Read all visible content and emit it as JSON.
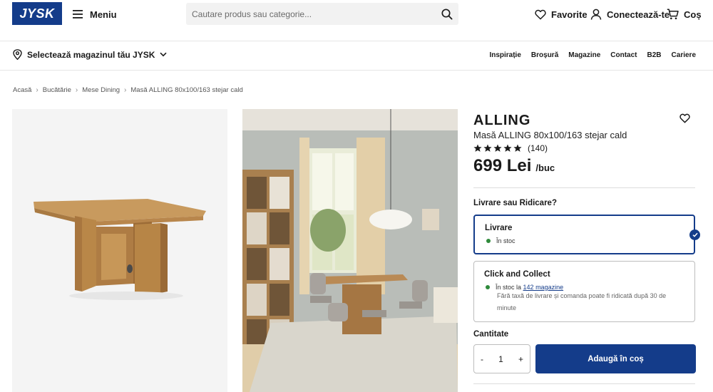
{
  "header": {
    "logo_text": "JYSK",
    "menu_label": "Meniu",
    "search_placeholder": "Cautare produs sau categorie...",
    "favorites_label": "Favorite",
    "login_label": "Conectează-te",
    "cart_label": "Coș"
  },
  "storebar": {
    "store_select_label": "Selectează magazinul tău JYSK",
    "links": [
      "Inspirație",
      "Broșură",
      "Magazine",
      "Contact",
      "B2B",
      "Cariere"
    ]
  },
  "breadcrumb": [
    "Acasă",
    "Bucătărie",
    "Mese Dining",
    "Masă ALLING 80x100/163 stejar cald"
  ],
  "product": {
    "brand": "ALLING",
    "subtitle": "Masă ALLING 80x100/163 stejar cald",
    "rating_stars": 5,
    "rating_count": "(140)",
    "price": "699 Lei",
    "price_unit": "/buc"
  },
  "delivery": {
    "section_title": "Livrare sau Ridicare?",
    "options": [
      {
        "title": "Livrare",
        "stock_text": "În stoc",
        "selected": true
      },
      {
        "title": "Click and Collect",
        "stock_prefix": "În stoc la",
        "stock_link": "142 magazine",
        "note": "Fără taxă de livrare și comanda poate fi ridicată după 30 de minute",
        "selected": false
      }
    ]
  },
  "quantity": {
    "label": "Cantitate",
    "minus": "-",
    "value": "1",
    "plus": "+"
  },
  "add_to_cart_label": "Adaugă în coș",
  "colors": {
    "brand_blue": "#143c8a",
    "stock_green": "#2f8a3b"
  }
}
